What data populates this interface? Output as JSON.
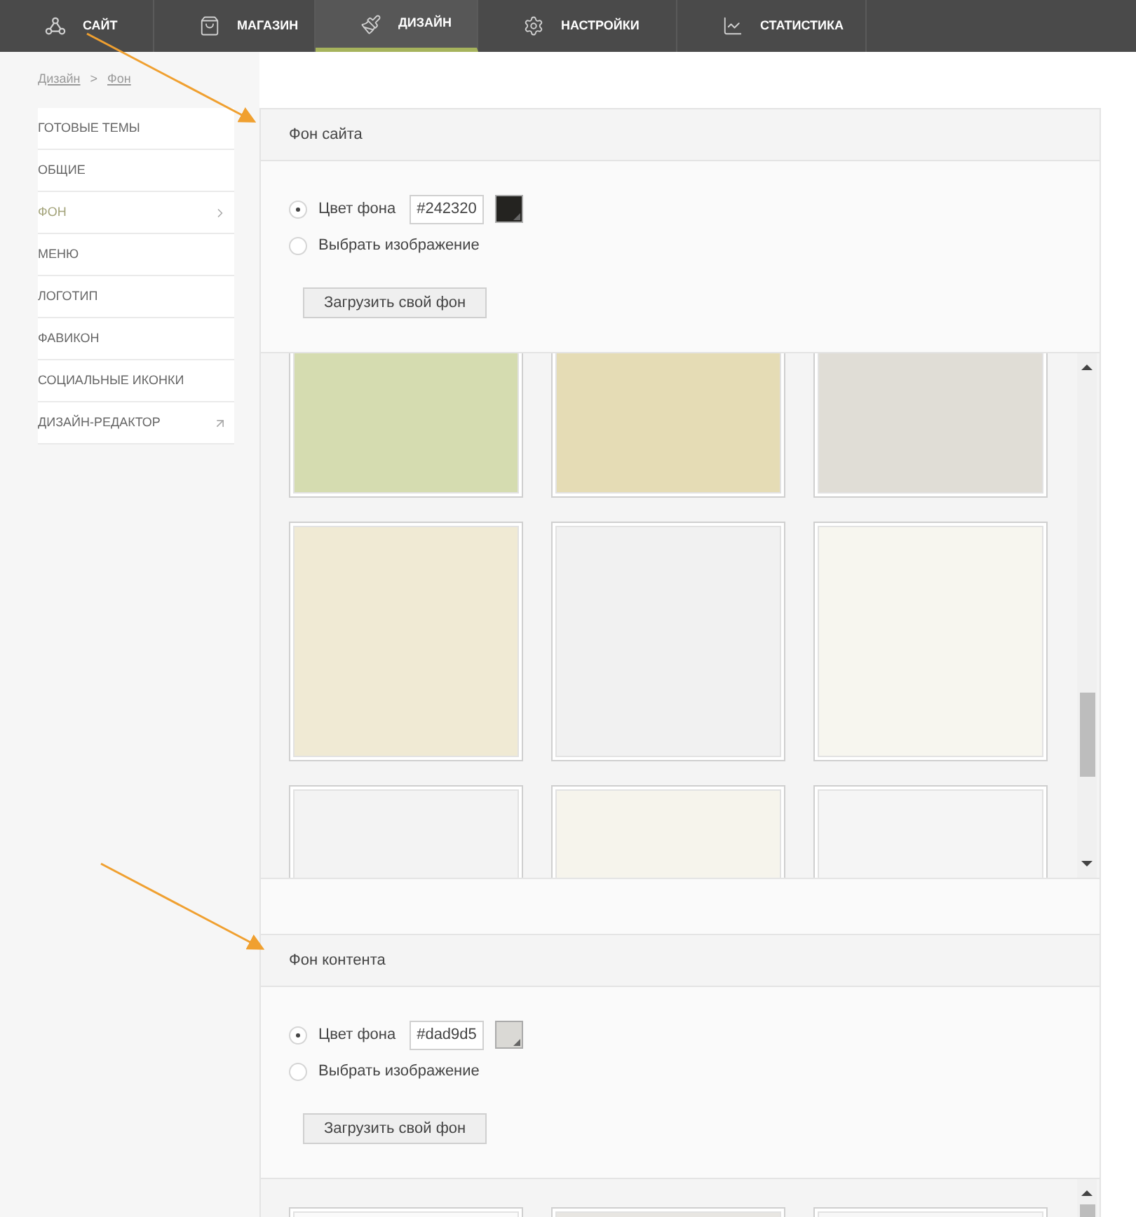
{
  "nav": [
    {
      "label": "САЙТ",
      "kind": "site",
      "selected": false
    },
    {
      "label": "МАГАЗИН",
      "kind": "shop",
      "selected": false
    },
    {
      "label": "ДИЗАЙН",
      "kind": "design",
      "selected": true
    },
    {
      "label": "НАСТРОЙКИ",
      "kind": "settings",
      "selected": false
    },
    {
      "label": "СТАТИСТИКА",
      "kind": "stats",
      "selected": false
    }
  ],
  "breadcrumb": [
    "Дизайн",
    "Фон"
  ],
  "breadcrumb_separator": ">",
  "sidebar": {
    "items": [
      {
        "label": "ГОТОВЫЕ ТЕМЫ",
        "kind": "page",
        "selected": false
      },
      {
        "label": "ОБЩИЕ",
        "kind": "page",
        "selected": false
      },
      {
        "label": "ФОН",
        "kind": "page",
        "selected": true
      },
      {
        "label": "МЕНЮ",
        "kind": "page",
        "selected": false
      },
      {
        "label": "ЛОГОТИП",
        "kind": "page",
        "selected": false
      },
      {
        "label": "ФАВИКОН",
        "kind": "page",
        "selected": false
      },
      {
        "label": "СОЦИАЛЬНЫЕ ИКОНКИ",
        "kind": "page",
        "selected": false
      },
      {
        "label": "ДИЗАЙН-РЕДАКТОР",
        "kind": "external",
        "selected": false
      }
    ]
  },
  "sections": [
    {
      "title": "Фон сайта",
      "options": [
        {
          "label": "Цвет фона",
          "selected": true,
          "kind": "color",
          "value": "#242320",
          "color": "#242320"
        },
        {
          "label": "Выбрать изображение",
          "selected": false,
          "kind": "image"
        }
      ],
      "upload_button": "Загрузить свой фон",
      "tiles": [
        {
          "color": "#d5dcb0"
        },
        {
          "color": "#e5dcb5"
        },
        {
          "color": "#e0ddd6"
        },
        {
          "color": "#f0ead4"
        },
        {
          "color": "#f1f1f1"
        },
        {
          "color": "#f7f6ef"
        },
        {
          "color": "#f3f3f3"
        },
        {
          "color": "#f6f4ec"
        },
        {
          "color": "#f5f5f5"
        }
      ]
    },
    {
      "title": "Фон контента",
      "options": [
        {
          "label": "Цвет фона",
          "selected": true,
          "kind": "color",
          "value": "#dad9d5",
          "color": "#dad9d5"
        },
        {
          "label": "Выбрать изображение",
          "selected": false,
          "kind": "image"
        }
      ],
      "upload_button": "Загрузить свой фон",
      "tiles": [
        {
          "color": "#fafafa"
        },
        {
          "color": "#e8e6e2"
        },
        {
          "color": "#f7f7f7"
        }
      ]
    }
  ]
}
